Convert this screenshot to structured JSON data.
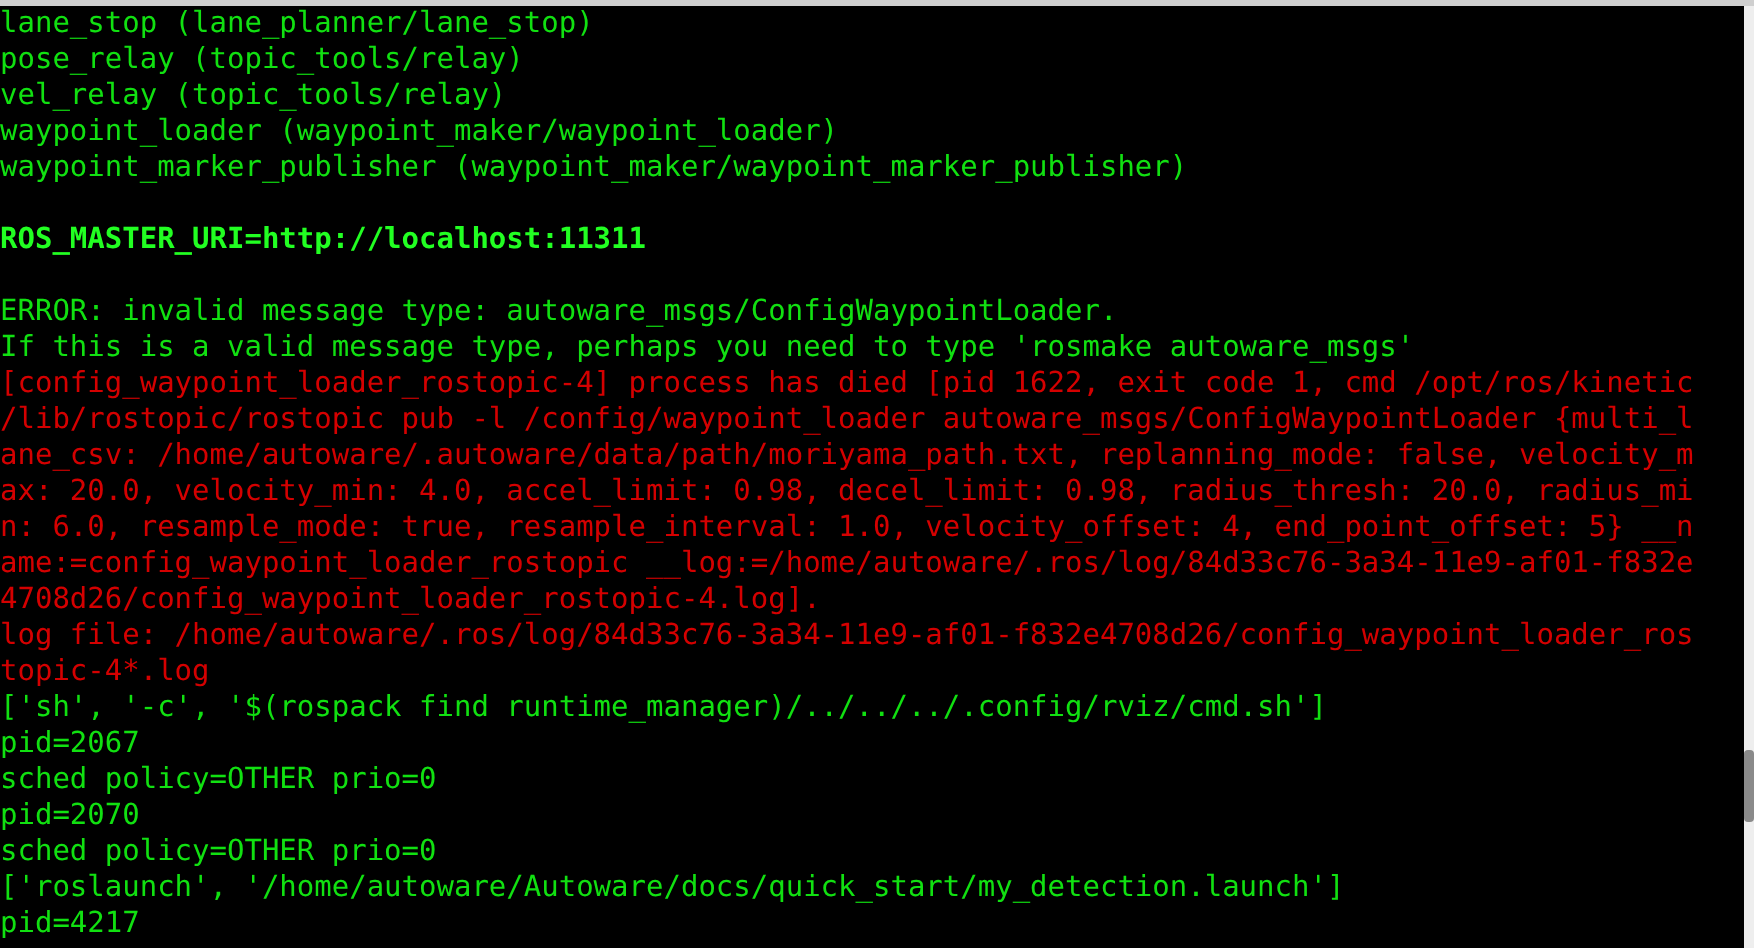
{
  "terminal": {
    "lines": [
      {
        "kind": "output",
        "text": "lane_stop (lane_planner/lane_stop)"
      },
      {
        "kind": "output",
        "text": "pose_relay (topic_tools/relay)"
      },
      {
        "kind": "output",
        "text": "vel_relay (topic_tools/relay)"
      },
      {
        "kind": "output",
        "text": "waypoint_loader (waypoint_maker/waypoint_loader)"
      },
      {
        "kind": "output",
        "text": "waypoint_marker_publisher (waypoint_maker/waypoint_marker_publisher)"
      },
      {
        "kind": "blank"
      },
      {
        "kind": "bold",
        "text": "ROS_MASTER_URI=http://localhost:11311"
      },
      {
        "kind": "blank"
      },
      {
        "kind": "output",
        "text": "ERROR: invalid message type: autoware_msgs/ConfigWaypointLoader."
      },
      {
        "kind": "output",
        "text": "If this is a valid message type, perhaps you need to type 'rosmake autoware_msgs'"
      },
      {
        "kind": "error",
        "text": "[config_waypoint_loader_rostopic-4] process has died [pid 1622, exit code 1, cmd /opt/ros/kinetic"
      },
      {
        "kind": "error",
        "text": "/lib/rostopic/rostopic pub -l /config/waypoint_loader autoware_msgs/ConfigWaypointLoader {multi_l"
      },
      {
        "kind": "error",
        "text": "ane_csv: /home/autoware/.autoware/data/path/moriyama_path.txt, replanning_mode: false, velocity_m"
      },
      {
        "kind": "error",
        "text": "ax: 20.0, velocity_min: 4.0, accel_limit: 0.98, decel_limit: 0.98, radius_thresh: 20.0, radius_mi"
      },
      {
        "kind": "error",
        "text": "n: 6.0, resample_mode: true, resample_interval: 1.0, velocity_offset: 4, end_point_offset: 5} __n"
      },
      {
        "kind": "error",
        "text": "ame:=config_waypoint_loader_rostopic __log:=/home/autoware/.ros/log/84d33c76-3a34-11e9-af01-f832e"
      },
      {
        "kind": "error",
        "text": "4708d26/config_waypoint_loader_rostopic-4.log]."
      },
      {
        "kind": "error",
        "text": "log file: /home/autoware/.ros/log/84d33c76-3a34-11e9-af01-f832e4708d26/config_waypoint_loader_ros"
      },
      {
        "kind": "error",
        "text": "topic-4*.log"
      },
      {
        "kind": "output",
        "text": "['sh', '-c', '$(rospack find runtime_manager)/../../../.config/rviz/cmd.sh']"
      },
      {
        "kind": "output",
        "text": "pid=2067"
      },
      {
        "kind": "output",
        "text": "sched policy=OTHER prio=0"
      },
      {
        "kind": "output",
        "text": "pid=2070"
      },
      {
        "kind": "output",
        "text": "sched policy=OTHER prio=0"
      },
      {
        "kind": "output",
        "text": "['roslaunch', '/home/autoware/Autoware/docs/quick_start/my_detection.launch']"
      },
      {
        "kind": "output",
        "text": "pid=4217"
      }
    ]
  }
}
